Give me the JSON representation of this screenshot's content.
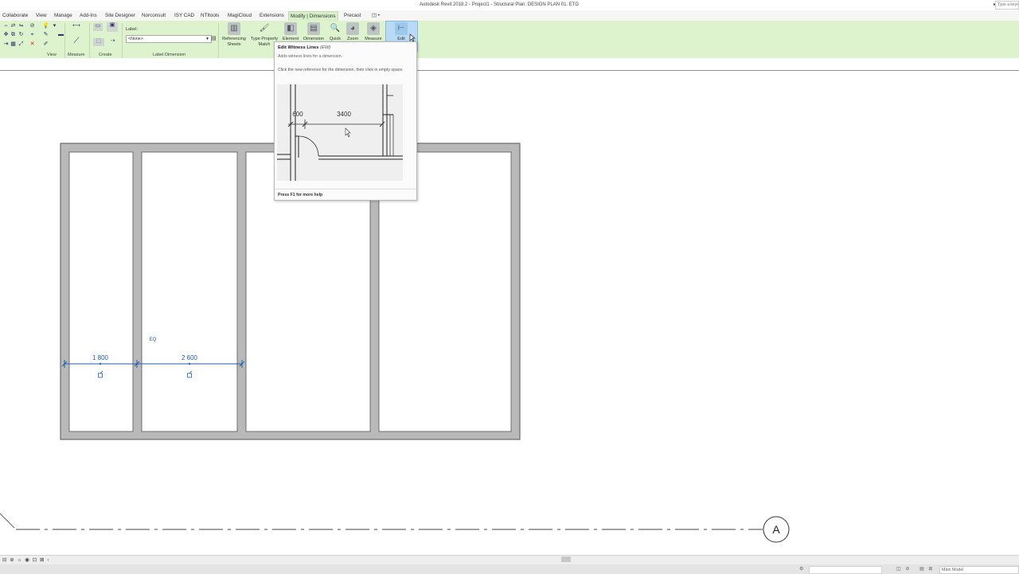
{
  "window": {
    "title": "Autodesk Revit 2018.2 -   Project1 - Structural Plan: DESIGN PLAN 01. ETG",
    "search_placeholder": "Type a keyword or phrase"
  },
  "tabs": [
    {
      "label": "Collaborate"
    },
    {
      "label": "View"
    },
    {
      "label": "Manage"
    },
    {
      "label": "Add-Ins"
    },
    {
      "label": "Site Designer"
    },
    {
      "label": "Norconsult"
    },
    {
      "label": "ISY CAD"
    },
    {
      "label": "NTItools"
    },
    {
      "label": "MagiCloud"
    },
    {
      "label": "Extensions"
    },
    {
      "label": "Modify | Dimensions",
      "active": true
    },
    {
      "label": "Precast"
    },
    {
      "label": "◫ •"
    }
  ],
  "ribbon": {
    "groups": {
      "view": "View",
      "measure": "Measure",
      "create": "Create",
      "label_dimension": "Label Dimension"
    },
    "label_field": {
      "title": "Label:",
      "value": "<None>"
    },
    "buttons": [
      {
        "line1": "Referencing",
        "line2": "Sheets",
        "icon": "sheets-icon"
      },
      {
        "line1": "Type Property",
        "line2": "Match",
        "icon": "match-icon"
      },
      {
        "line1": "Element",
        "line2": "",
        "icon": "element-icon"
      },
      {
        "line1": "Dimension",
        "line2": "",
        "icon": "dimension-icon"
      },
      {
        "line1": "Quick",
        "line2": "",
        "icon": "quick-icon"
      },
      {
        "line1": "Zoom",
        "line2": "",
        "icon": "zoom-icon"
      },
      {
        "line1": "Measure",
        "line2": "",
        "icon": "measure-icon"
      },
      {
        "line1": "Edit",
        "line2": "",
        "icon": "edit-witness-lines-icon",
        "active": true
      }
    ]
  },
  "tooltip": {
    "title": "Edit Witness Lines",
    "shortcut": "(EW)",
    "description": "Adds witness lines for a dimension.",
    "instruction": "Click the new reference for the dimension, then click in empty space.",
    "image_dims": {
      "left": "600",
      "right": "3400"
    },
    "help": "Press F1 for more help"
  },
  "drawing": {
    "dimensions": [
      {
        "label": "1 800"
      },
      {
        "label": "2 600"
      }
    ],
    "eq_label": "EQ",
    "grid_label": "A"
  },
  "statusbar": {
    "model": "Main Model"
  },
  "colors": {
    "ribbon": "#dcf3cd",
    "dimension": "#1f5fb0",
    "wall_fill": "#b9b9b9",
    "active_button": "#b9daf4"
  }
}
